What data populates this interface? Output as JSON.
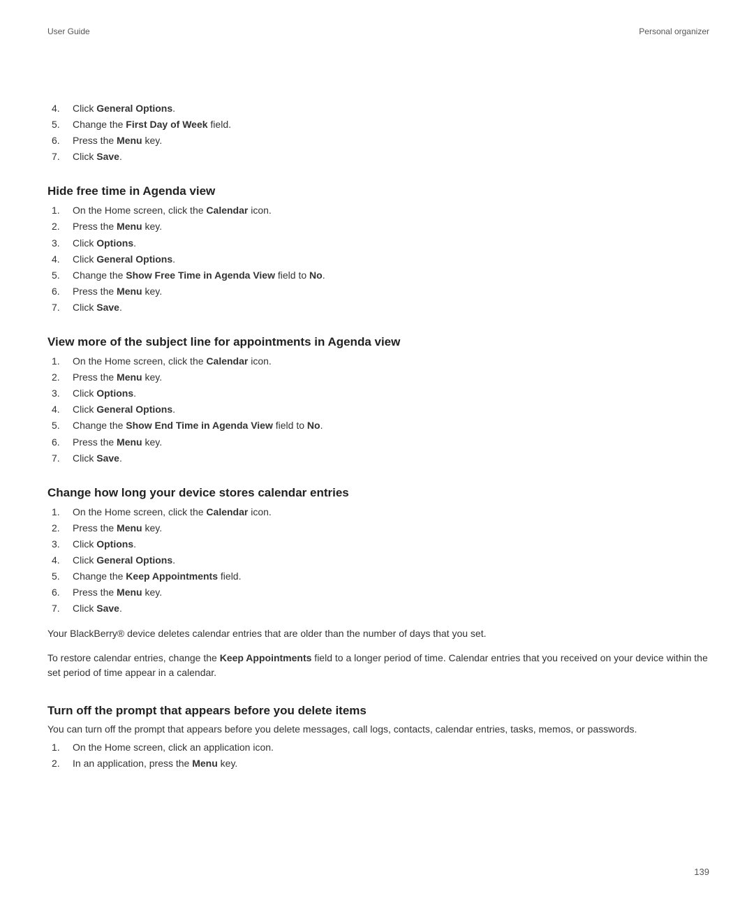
{
  "header": {
    "left": "User Guide",
    "right": "Personal organizer"
  },
  "section0": {
    "steps": [
      {
        "pre": "Click ",
        "bold": "General Options",
        "post": "."
      },
      {
        "pre": "Change the ",
        "bold": "First Day of Week",
        "post": " field."
      },
      {
        "pre": "Press the ",
        "bold": "Menu",
        "post": " key."
      },
      {
        "pre": "Click ",
        "bold": "Save",
        "post": "."
      }
    ],
    "start": 4
  },
  "section1": {
    "heading": "Hide free time in Agenda view",
    "steps": [
      {
        "pre": "On the Home screen, click the ",
        "bold": "Calendar",
        "post": " icon."
      },
      {
        "pre": "Press the ",
        "bold": "Menu",
        "post": " key."
      },
      {
        "pre": "Click ",
        "bold": "Options",
        "post": "."
      },
      {
        "pre": "Click ",
        "bold": "General Options",
        "post": "."
      },
      {
        "pre": "Change the ",
        "bold": "Show Free Time in Agenda View",
        "post": " field to ",
        "bold2": "No",
        "post2": "."
      },
      {
        "pre": "Press the ",
        "bold": "Menu",
        "post": " key."
      },
      {
        "pre": "Click ",
        "bold": "Save",
        "post": "."
      }
    ]
  },
  "section2": {
    "heading": "View more of the subject line for appointments in Agenda view",
    "steps": [
      {
        "pre": "On the Home screen, click the ",
        "bold": "Calendar",
        "post": " icon."
      },
      {
        "pre": "Press the ",
        "bold": "Menu",
        "post": " key."
      },
      {
        "pre": "Click ",
        "bold": "Options",
        "post": "."
      },
      {
        "pre": "Click ",
        "bold": "General Options",
        "post": "."
      },
      {
        "pre": "Change the ",
        "bold": "Show End Time in Agenda View",
        "post": " field to ",
        "bold2": "No",
        "post2": "."
      },
      {
        "pre": "Press the ",
        "bold": "Menu",
        "post": " key."
      },
      {
        "pre": "Click ",
        "bold": "Save",
        "post": "."
      }
    ]
  },
  "section3": {
    "heading": "Change how long your device stores calendar entries",
    "steps": [
      {
        "pre": "On the Home screen, click the ",
        "bold": "Calendar",
        "post": " icon."
      },
      {
        "pre": "Press the ",
        "bold": "Menu",
        "post": " key."
      },
      {
        "pre": "Click ",
        "bold": "Options",
        "post": "."
      },
      {
        "pre": "Click ",
        "bold": "General Options",
        "post": "."
      },
      {
        "pre": "Change the ",
        "bold": "Keep Appointments",
        "post": " field."
      },
      {
        "pre": "Press the ",
        "bold": "Menu",
        "post": " key."
      },
      {
        "pre": "Click ",
        "bold": "Save",
        "post": "."
      }
    ],
    "para1": "Your BlackBerry® device deletes calendar entries that are older than the number of days that you set.",
    "para2_pre": "To restore calendar entries, change the ",
    "para2_bold": "Keep Appointments",
    "para2_post": " field to a longer period of time. Calendar entries that you received on your device within the set period of time appear in a calendar."
  },
  "section4": {
    "heading": "Turn off the prompt that appears before you delete items",
    "intro": "You can turn off the prompt that appears before you delete messages, call logs, contacts, calendar entries, tasks, memos, or passwords.",
    "steps": [
      {
        "pre": "On the Home screen, click an application icon.",
        "bold": "",
        "post": ""
      },
      {
        "pre": "In an application, press the ",
        "bold": "Menu",
        "post": " key."
      }
    ]
  },
  "page_number": "139"
}
